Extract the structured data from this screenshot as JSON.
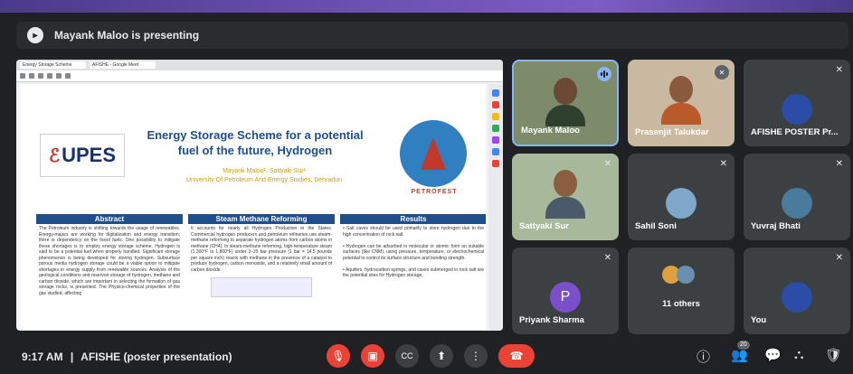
{
  "presenting": {
    "text": "Mayank Maloo is presenting"
  },
  "browser": {
    "tab1": "Energy Storage Scheme",
    "tab2": "AFISHE - Google Meet"
  },
  "poster": {
    "logo_left": "UPES",
    "title_line1": "Energy Storage Scheme for a potential",
    "title_line2": "fuel of the future, Hydrogen",
    "authors": "Mayank Maloo¹, Sattyaki Sur¹",
    "affiliation": "University Of Petroleum And Energy Studies, Dehradun",
    "logo_right": "PETROFEST",
    "sections": [
      {
        "heading": "Abstract",
        "body": "The Petroleum industry is shifting towards the usage of renewables. Energy-majors are working for digitalization and energy transition; there is dependency on the fossil fuels. One possibility to mitigate these shortages is to employ energy storage scheme. Hydrogen is said to be a potential fuel when properly handled. Significant storage phenomenon is being developed for storing hydrogen. Subsurface porous media hydrogen storage could be a viable option to mitigate shortages in energy supply from renewable sources. Analysis of the geological conditions and reservoir storage of hydrogen, methane and carbon dioxide, which are important in selecting the formation of gas storage rocks, is presented. The Physico-chemical properties of the gas studied, affecting"
      },
      {
        "heading": "Steam Methane Reforming",
        "body": "It accounts for nearly all Hydrogen Production in the States. Commercial hydrogen producers and petroleum refineries use steam-methane reforming to separate hydrogen atoms from carbon atoms in methane (CH4). In steam-methane reforming, high-temperature steam (1,300°F to 1,800°F) under 3–25 bar pressure (1 bar = 14.5 pounds per square inch) reacts with methane in the presence of a catalyst to produce hydrogen, carbon monoxide, and a relatively small amount of carbon dioxide."
      },
      {
        "heading": "Results",
        "body": "• Salt caves should be used primarily to store hydrogen due to the high concentration of rock salt.\n\n• Hydrogen can be adsorbed in molecular or atomic form on suitable surfaces (like CNM), using pressure, temperature, or electrochemical potential to control its surface structure and bonding strength.\n\n• Aquifers, hydrocarbon springs, and caves submerged in rock salt are the potential sites for Hydrogen storage."
      }
    ]
  },
  "participants": [
    {
      "name": "Mayank Maloo",
      "type": "video",
      "speaking": true
    },
    {
      "name": "Prasenjit Talukdar",
      "type": "video",
      "muted": true
    },
    {
      "name": "AFISHE POSTER Pr...",
      "type": "avatar",
      "avatar_color": "#2b4da8",
      "muted": true
    },
    {
      "name": "Sattyaki Sur",
      "type": "video",
      "muted": true
    },
    {
      "name": "Sahil Soni",
      "type": "avatar",
      "avatar_color": "#7fa7c9",
      "muted": true
    },
    {
      "name": "Yuvraj Bhati",
      "type": "avatar",
      "avatar_color": "#4a7a9c",
      "muted": true
    },
    {
      "name": "Priyank Sharma",
      "type": "avatar",
      "avatar_letter": "P",
      "avatar_color": "#7b4fc9",
      "muted": true
    },
    {
      "name": "11 others",
      "type": "group"
    },
    {
      "name": "You",
      "type": "avatar",
      "avatar_color": "#2b4da8",
      "muted": true
    }
  ],
  "bottom": {
    "time": "9:17 AM",
    "separator": "|",
    "meeting": "AFISHE (poster presentation)",
    "people_count": "20"
  },
  "colors": {
    "accent": "#8ab4f8",
    "danger": "#ea4335",
    "bg": "#202124",
    "tile": "#3c4043"
  },
  "icons": [
    "mic-off-icon",
    "camera-off-icon",
    "captions-icon",
    "present-icon",
    "more-icon",
    "hangup-icon",
    "info-icon",
    "people-icon",
    "chat-icon",
    "activities-icon",
    "host-controls-icon"
  ]
}
